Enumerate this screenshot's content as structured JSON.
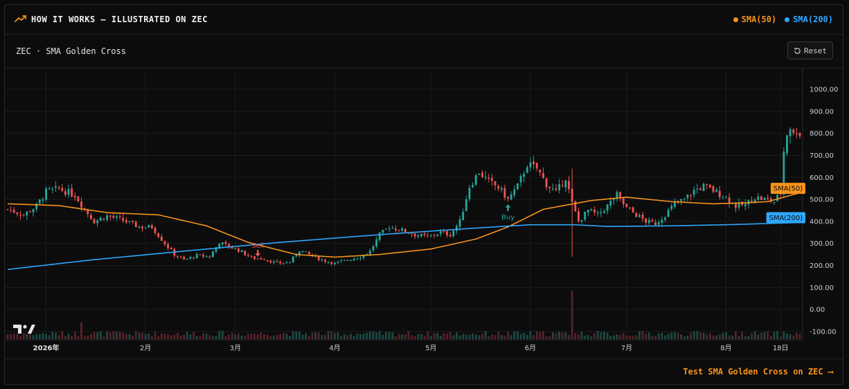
{
  "header": {
    "title": "HOW IT WORKS — ILLUSTRATED ON ZEC",
    "legend": [
      {
        "label": "SMA(50)",
        "color": "#f7931a"
      },
      {
        "label": "SMA(200)",
        "color": "#2ea8ff"
      }
    ]
  },
  "subheader": {
    "title": "ZEC · SMA Golden Cross",
    "reset_label": "Reset",
    "reset_icon": "reset-icon"
  },
  "footer": {
    "cta_label": "Test SMA Golden Cross on ZEC ⟶"
  },
  "colors": {
    "up": "#26a69a",
    "down": "#ef5350",
    "sma50": "#f7931a",
    "sma200": "#2ea8ff",
    "buy": "#26a69a",
    "sell": "#ef5350"
  },
  "chart_data": {
    "type": "line",
    "price_type": "candlestick",
    "ylim": [
      -100,
      1000
    ],
    "yticks": [
      1000,
      900,
      800,
      700,
      600,
      500,
      400,
      300,
      200,
      100,
      0,
      -100
    ],
    "ytick_labels": [
      "1000.00",
      "900.00",
      "800.00",
      "700.00",
      "600.00",
      "500.00",
      "400.00",
      "300.00",
      "200.00",
      "100.00",
      "0.00",
      "-100.00"
    ],
    "x_range": [
      "2025-12-20",
      "2026-08-24"
    ],
    "x_labels": [
      {
        "date": "2026-01-01",
        "label": "2026年",
        "bold": true
      },
      {
        "date": "2026-02-01",
        "label": "2月",
        "bold": false
      },
      {
        "date": "2026-03-01",
        "label": "3月",
        "bold": false
      },
      {
        "date": "2026-04-01",
        "label": "4月",
        "bold": false
      },
      {
        "date": "2026-05-01",
        "label": "5月",
        "bold": false
      },
      {
        "date": "2026-06-01",
        "label": "6月",
        "bold": false
      },
      {
        "date": "2026-07-01",
        "label": "7月",
        "bold": false
      },
      {
        "date": "2026-08-01",
        "label": "8月",
        "bold": false
      },
      {
        "date": "2026-08-18",
        "label": "18日",
        "bold": false
      }
    ],
    "close_keypoints": [
      [
        "2025-12-20",
        455
      ],
      [
        "2025-12-25",
        430
      ],
      [
        "2025-12-29",
        470
      ],
      [
        "2026-01-01",
        535
      ],
      [
        "2026-01-05",
        548
      ],
      [
        "2026-01-10",
        520
      ],
      [
        "2026-01-13",
        455
      ],
      [
        "2026-01-16",
        400
      ],
      [
        "2026-01-20",
        425
      ],
      [
        "2026-01-25",
        405
      ],
      [
        "2026-01-30",
        375
      ],
      [
        "2026-02-03",
        375
      ],
      [
        "2026-02-07",
        300
      ],
      [
        "2026-02-10",
        250
      ],
      [
        "2026-02-13",
        225
      ],
      [
        "2026-02-17",
        245
      ],
      [
        "2026-02-21",
        240
      ],
      [
        "2026-02-24",
        305
      ],
      [
        "2026-02-27",
        285
      ],
      [
        "2026-03-02",
        270
      ],
      [
        "2026-03-06",
        235
      ],
      [
        "2026-03-10",
        230
      ],
      [
        "2026-03-14",
        210
      ],
      [
        "2026-03-18",
        215
      ],
      [
        "2026-03-21",
        270
      ],
      [
        "2026-03-24",
        250
      ],
      [
        "2026-03-28",
        225
      ],
      [
        "2026-04-01",
        210
      ],
      [
        "2026-04-05",
        225
      ],
      [
        "2026-04-09",
        240
      ],
      [
        "2026-04-12",
        265
      ],
      [
        "2026-04-15",
        340
      ],
      [
        "2026-04-18",
        375
      ],
      [
        "2026-04-22",
        360
      ],
      [
        "2026-04-26",
        340
      ],
      [
        "2026-04-30",
        330
      ],
      [
        "2026-05-04",
        350
      ],
      [
        "2026-05-07",
        340
      ],
      [
        "2026-05-10",
        400
      ],
      [
        "2026-05-13",
        560
      ],
      [
        "2026-05-16",
        625
      ],
      [
        "2026-05-19",
        580
      ],
      [
        "2026-05-22",
        555
      ],
      [
        "2026-05-25",
        500
      ],
      [
        "2026-05-28",
        560
      ],
      [
        "2026-05-31",
        660
      ],
      [
        "2026-06-03",
        640
      ],
      [
        "2026-06-06",
        570
      ],
      [
        "2026-06-09",
        530
      ],
      [
        "2026-06-12",
        600
      ],
      [
        "2026-06-14",
        480
      ],
      [
        "2026-06-16",
        400
      ],
      [
        "2026-06-19",
        450
      ],
      [
        "2026-06-22",
        430
      ],
      [
        "2026-06-25",
        470
      ],
      [
        "2026-06-28",
        520
      ],
      [
        "2026-07-01",
        460
      ],
      [
        "2026-07-04",
        430
      ],
      [
        "2026-07-07",
        400
      ],
      [
        "2026-07-10",
        390
      ],
      [
        "2026-07-13",
        430
      ],
      [
        "2026-07-16",
        480
      ],
      [
        "2026-07-19",
        500
      ],
      [
        "2026-07-22",
        540
      ],
      [
        "2026-07-25",
        560
      ],
      [
        "2026-07-28",
        540
      ],
      [
        "2026-08-01",
        510
      ],
      [
        "2026-08-04",
        470
      ],
      [
        "2026-08-07",
        475
      ],
      [
        "2026-08-10",
        510
      ],
      [
        "2026-08-13",
        500
      ],
      [
        "2026-08-16",
        490
      ],
      [
        "2026-08-18",
        530
      ],
      [
        "2026-08-19",
        720
      ],
      [
        "2026-08-20",
        800
      ],
      [
        "2026-08-21",
        830
      ],
      [
        "2026-08-22",
        790
      ],
      [
        "2026-08-23",
        815
      ],
      [
        "2026-08-24",
        800
      ]
    ],
    "series": [
      {
        "name": "SMA(50)",
        "points": [
          [
            "2025-12-20",
            480
          ],
          [
            "2026-01-05",
            472
          ],
          [
            "2026-01-20",
            440
          ],
          [
            "2026-02-05",
            430
          ],
          [
            "2026-02-20",
            380
          ],
          [
            "2026-03-05",
            305
          ],
          [
            "2026-03-20",
            250
          ],
          [
            "2026-04-01",
            238
          ],
          [
            "2026-04-15",
            250
          ],
          [
            "2026-05-01",
            275
          ],
          [
            "2026-05-15",
            320
          ],
          [
            "2026-05-25",
            375
          ],
          [
            "2026-06-05",
            455
          ],
          [
            "2026-06-20",
            495
          ],
          [
            "2026-07-01",
            510
          ],
          [
            "2026-07-15",
            490
          ],
          [
            "2026-07-28",
            480
          ],
          [
            "2026-08-08",
            485
          ],
          [
            "2026-08-14",
            490
          ],
          [
            "2026-08-24",
            530
          ]
        ]
      },
      {
        "name": "SMA(200)",
        "points": [
          [
            "2025-12-20",
            182
          ],
          [
            "2026-01-15",
            225
          ],
          [
            "2026-02-15",
            268
          ],
          [
            "2026-03-15",
            305
          ],
          [
            "2026-04-15",
            340
          ],
          [
            "2026-05-15",
            370
          ],
          [
            "2026-06-01",
            385
          ],
          [
            "2026-06-15",
            385
          ],
          [
            "2026-06-25",
            377
          ],
          [
            "2026-07-15",
            380
          ],
          [
            "2026-08-01",
            385
          ],
          [
            "2026-08-24",
            395
          ]
        ]
      }
    ],
    "line_labels": [
      {
        "label": "SMA(50)",
        "value": 550
      },
      {
        "label": "SMA(200)",
        "value": 417
      }
    ],
    "signals": [
      {
        "type": "sell",
        "label": "Sell",
        "date": "2026-03-08",
        "value": 255
      },
      {
        "type": "buy",
        "label": "Buy",
        "date": "2026-05-25",
        "value": 485
      }
    ],
    "volume_spikes": [
      {
        "date": "2026-01-12",
        "value": 0.35
      },
      {
        "date": "2026-06-14",
        "value": 1.0
      }
    ],
    "grid": true,
    "legend": "top-right"
  }
}
